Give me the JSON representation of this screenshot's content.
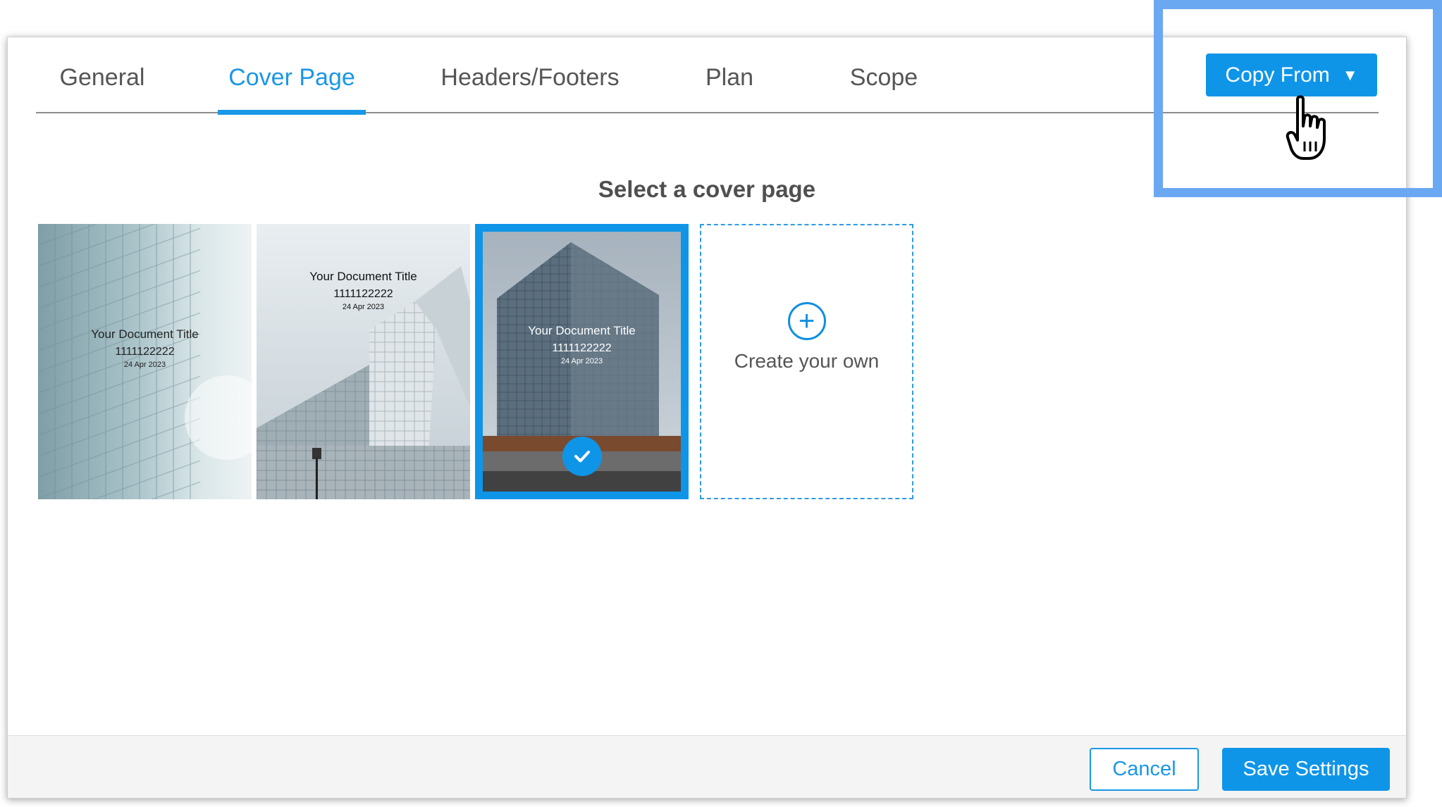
{
  "tabs": [
    {
      "label": "General",
      "active": false
    },
    {
      "label": "Cover Page",
      "active": true
    },
    {
      "label": "Headers/Footers",
      "active": false
    },
    {
      "label": "Plan",
      "active": false
    },
    {
      "label": "Scope",
      "active": false
    }
  ],
  "copy_from": {
    "label": "Copy From",
    "caret": "▼"
  },
  "heading": "Select a cover page",
  "cover_pages": [
    {
      "title": "Your Document Title",
      "number": "1111122222",
      "date": "24 Apr 2023",
      "selected": false
    },
    {
      "title": "Your Document Title",
      "number": "1111122222",
      "date": "24 Apr 2023",
      "selected": false
    },
    {
      "title": "Your Document Title",
      "number": "1111122222",
      "date": "24 Apr 2023",
      "selected": true
    }
  ],
  "create_own": {
    "label": "Create your own",
    "icon": "plus-circle-icon"
  },
  "footer": {
    "cancel_label": "Cancel",
    "save_label": "Save Settings"
  },
  "colors": {
    "accent": "#0f95e8",
    "highlight": "#6ba8f2"
  }
}
